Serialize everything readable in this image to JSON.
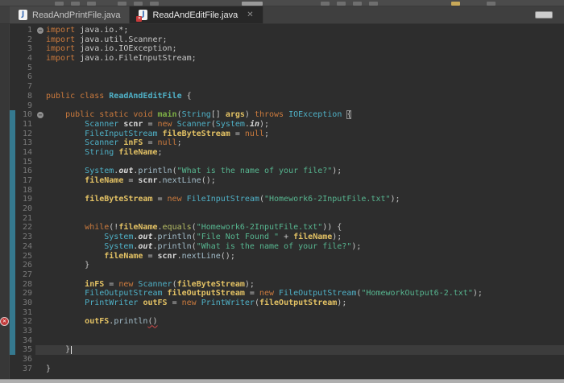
{
  "toolbar": {
    "description": "main toolbar clipped at top edge",
    "clipped_icon_count": 13
  },
  "tabs": [
    {
      "label": "ReadAndPrintFile.java",
      "active": false,
      "error_badge": false,
      "closable": false
    },
    {
      "label": "ReadAndEditFile.java",
      "active": true,
      "error_badge": true,
      "closable": true
    }
  ],
  "colors": {
    "editor_background": "#2d2d2d",
    "keyword": "#cb7a3d",
    "type": "#4fb1c7",
    "method_declaration": "#7daf45",
    "variable": "#e2c164",
    "string": "#57b690",
    "plain_text": "#c6c6c6",
    "line_number": "#7a7a7a",
    "range_indicator": "#35798f",
    "current_line_highlight": "#3c3c3c",
    "error_marker": "#c23a3a"
  },
  "editor": {
    "language": "java",
    "range_start": 10,
    "range_end": 35,
    "error_line": 32,
    "current_line": 35,
    "lines": [
      {
        "n": 1,
        "fold": true,
        "segs": [
          [
            "kw",
            "import"
          ],
          [
            "pl",
            " java.io.*;"
          ]
        ]
      },
      {
        "n": 2,
        "segs": [
          [
            "kw",
            "import"
          ],
          [
            "pl",
            " java.util.Scanner;"
          ]
        ]
      },
      {
        "n": 3,
        "segs": [
          [
            "kw",
            "import"
          ],
          [
            "pl",
            " java.io.IOException;"
          ]
        ]
      },
      {
        "n": 4,
        "segs": [
          [
            "kw",
            "import"
          ],
          [
            "pl",
            " java.io.FileInputStream;"
          ]
        ]
      },
      {
        "n": 5,
        "segs": []
      },
      {
        "n": 6,
        "segs": []
      },
      {
        "n": 7,
        "segs": []
      },
      {
        "n": 8,
        "segs": [
          [
            "kw",
            "public class"
          ],
          [
            "pl",
            " "
          ],
          [
            "tyb",
            "ReadAndEditFile"
          ],
          [
            "pl",
            " {"
          ]
        ]
      },
      {
        "n": 9,
        "segs": []
      },
      {
        "n": 10,
        "fold": true,
        "segs": [
          [
            "pl",
            "    "
          ],
          [
            "kw",
            "public static void"
          ],
          [
            "pl",
            " "
          ],
          [
            "me",
            "main"
          ],
          [
            "pl",
            "("
          ],
          [
            "ty",
            "String"
          ],
          [
            "pl",
            "[] "
          ],
          [
            "va",
            "args"
          ],
          [
            "pl",
            ") "
          ],
          [
            "kw",
            "throws"
          ],
          [
            "pl",
            " "
          ],
          [
            "ty",
            "IOException"
          ],
          [
            "pl",
            " "
          ],
          [
            "bx",
            "{"
          ]
        ]
      },
      {
        "n": 11,
        "segs": [
          [
            "pl",
            "        "
          ],
          [
            "ty",
            "Scanner"
          ],
          [
            "pl",
            " "
          ],
          [
            "vb",
            "scnr"
          ],
          [
            "pl",
            " = "
          ],
          [
            "kw",
            "new"
          ],
          [
            "pl",
            " "
          ],
          [
            "ty",
            "Scanner"
          ],
          [
            "pl",
            "("
          ],
          [
            "ty",
            "System"
          ],
          [
            "pl",
            "."
          ],
          [
            "fl",
            "in"
          ],
          [
            "pl",
            ");"
          ]
        ]
      },
      {
        "n": 12,
        "segs": [
          [
            "pl",
            "        "
          ],
          [
            "ty",
            "FileInputStream"
          ],
          [
            "pl",
            " "
          ],
          [
            "va",
            "fileByteStream"
          ],
          [
            "pl",
            " = "
          ],
          [
            "kw",
            "null"
          ],
          [
            "pl",
            ";"
          ]
        ]
      },
      {
        "n": 13,
        "segs": [
          [
            "pl",
            "        "
          ],
          [
            "ty",
            "Scanner"
          ],
          [
            "pl",
            " "
          ],
          [
            "va",
            "inFS"
          ],
          [
            "pl",
            " = "
          ],
          [
            "kw",
            "null"
          ],
          [
            "pl",
            ";"
          ]
        ]
      },
      {
        "n": 14,
        "segs": [
          [
            "pl",
            "        "
          ],
          [
            "ty",
            "String"
          ],
          [
            "pl",
            " "
          ],
          [
            "va",
            "fileName"
          ],
          [
            "pl",
            ";"
          ]
        ]
      },
      {
        "n": 15,
        "segs": []
      },
      {
        "n": 16,
        "segs": [
          [
            "pl",
            "        "
          ],
          [
            "ty",
            "System"
          ],
          [
            "pl",
            "."
          ],
          [
            "fl",
            "out"
          ],
          [
            "pl",
            "."
          ],
          [
            "mi",
            "println"
          ],
          [
            "pl",
            "("
          ],
          [
            "st",
            "\"What is the name of your file?\""
          ],
          [
            "pl",
            ");"
          ]
        ]
      },
      {
        "n": 17,
        "segs": [
          [
            "pl",
            "        "
          ],
          [
            "va",
            "fileName"
          ],
          [
            "pl",
            " = "
          ],
          [
            "vb",
            "scnr"
          ],
          [
            "pl",
            "."
          ],
          [
            "mi",
            "nextLine"
          ],
          [
            "pl",
            "();"
          ]
        ]
      },
      {
        "n": 18,
        "segs": []
      },
      {
        "n": 19,
        "segs": [
          [
            "pl",
            "        "
          ],
          [
            "va",
            "fileByteStream"
          ],
          [
            "pl",
            " = "
          ],
          [
            "kw",
            "new"
          ],
          [
            "pl",
            " "
          ],
          [
            "ty",
            "FileInputStream"
          ],
          [
            "pl",
            "("
          ],
          [
            "st",
            "\"Homework6-2InputFile.txt\""
          ],
          [
            "pl",
            ");"
          ]
        ]
      },
      {
        "n": 20,
        "segs": []
      },
      {
        "n": 21,
        "segs": []
      },
      {
        "n": 22,
        "segs": [
          [
            "pl",
            "        "
          ],
          [
            "kw",
            "while"
          ],
          [
            "pl",
            "(!"
          ],
          [
            "va",
            "fileName"
          ],
          [
            "pl",
            "."
          ],
          [
            "ol",
            "equals"
          ],
          [
            "pl",
            "("
          ],
          [
            "st",
            "\"Homework6-2InputFile.txt\""
          ],
          [
            "pl",
            ")) {"
          ]
        ]
      },
      {
        "n": 23,
        "segs": [
          [
            "pl",
            "            "
          ],
          [
            "ty",
            "System"
          ],
          [
            "pl",
            "."
          ],
          [
            "fl",
            "out"
          ],
          [
            "pl",
            "."
          ],
          [
            "mi",
            "println"
          ],
          [
            "pl",
            "("
          ],
          [
            "st",
            "\"File Not Found \""
          ],
          [
            "pl",
            " + "
          ],
          [
            "va",
            "fileName"
          ],
          [
            "pl",
            ");"
          ]
        ]
      },
      {
        "n": 24,
        "segs": [
          [
            "pl",
            "            "
          ],
          [
            "ty",
            "System"
          ],
          [
            "pl",
            "."
          ],
          [
            "fl",
            "out"
          ],
          [
            "pl",
            "."
          ],
          [
            "mi",
            "println"
          ],
          [
            "pl",
            "("
          ],
          [
            "st",
            "\"What is the name of your file?\""
          ],
          [
            "pl",
            ");"
          ]
        ]
      },
      {
        "n": 25,
        "segs": [
          [
            "pl",
            "            "
          ],
          [
            "va",
            "fileName"
          ],
          [
            "pl",
            " = "
          ],
          [
            "vb",
            "scnr"
          ],
          [
            "pl",
            "."
          ],
          [
            "mi",
            "nextLine"
          ],
          [
            "pl",
            "();"
          ]
        ]
      },
      {
        "n": 26,
        "segs": [
          [
            "pl",
            "        }"
          ]
        ]
      },
      {
        "n": 27,
        "segs": []
      },
      {
        "n": 28,
        "segs": [
          [
            "pl",
            "        "
          ],
          [
            "va",
            "inFS"
          ],
          [
            "pl",
            " = "
          ],
          [
            "kw",
            "new"
          ],
          [
            "pl",
            " "
          ],
          [
            "ty",
            "Scanner"
          ],
          [
            "pl",
            "("
          ],
          [
            "va",
            "fileByteStream"
          ],
          [
            "pl",
            ");"
          ]
        ]
      },
      {
        "n": 29,
        "segs": [
          [
            "pl",
            "        "
          ],
          [
            "ty",
            "FileOutputStream"
          ],
          [
            "pl",
            " "
          ],
          [
            "va",
            "fileOutputStream"
          ],
          [
            "pl",
            " = "
          ],
          [
            "kw",
            "new"
          ],
          [
            "pl",
            " "
          ],
          [
            "ty",
            "FileOutputStream"
          ],
          [
            "pl",
            "("
          ],
          [
            "st",
            "\"HomeworkOutput6-2.txt\""
          ],
          [
            "pl",
            ");"
          ]
        ]
      },
      {
        "n": 30,
        "segs": [
          [
            "pl",
            "        "
          ],
          [
            "ty",
            "PrintWriter"
          ],
          [
            "pl",
            " "
          ],
          [
            "va",
            "outFS"
          ],
          [
            "pl",
            " = "
          ],
          [
            "kw",
            "new"
          ],
          [
            "pl",
            " "
          ],
          [
            "ty",
            "PrintWriter"
          ],
          [
            "pl",
            "("
          ],
          [
            "va",
            "fileOutputStream"
          ],
          [
            "pl",
            ");"
          ]
        ]
      },
      {
        "n": 31,
        "segs": []
      },
      {
        "n": 32,
        "error": true,
        "segs": [
          [
            "pl",
            "        "
          ],
          [
            "va",
            "outFS"
          ],
          [
            "pl",
            "."
          ],
          [
            "mi",
            "println"
          ],
          [
            "er",
            "()"
          ]
        ]
      },
      {
        "n": 33,
        "segs": []
      },
      {
        "n": 34,
        "segs": []
      },
      {
        "n": 35,
        "current": true,
        "cursor_after": true,
        "segs": [
          [
            "pl",
            "    }"
          ]
        ]
      },
      {
        "n": 36,
        "segs": []
      },
      {
        "n": 37,
        "segs": [
          [
            "pl",
            "}"
          ]
        ]
      }
    ]
  }
}
